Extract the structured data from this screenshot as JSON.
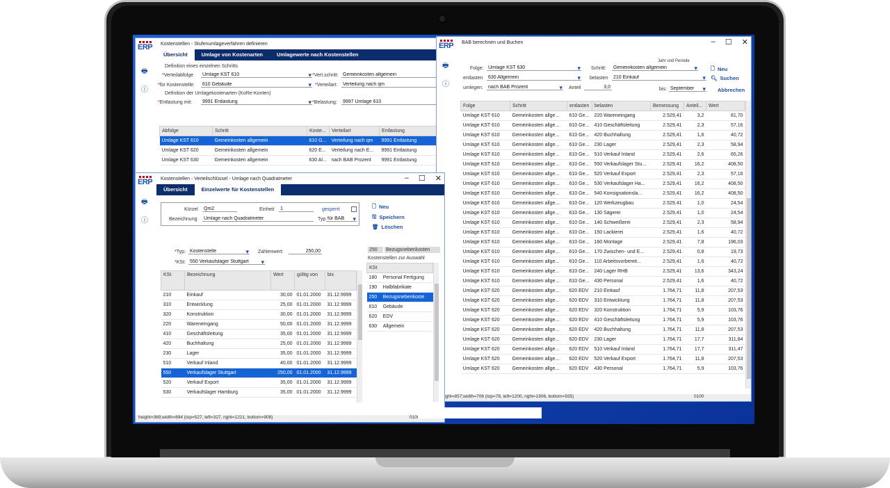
{
  "win1": {
    "title": "Kostenstellen - Stufenumlageverfahren definieren",
    "tabs": [
      "Übersicht",
      "Umlage von Kostenarten",
      "Umlagewerte nach Kostenstellen"
    ],
    "section1": "Definition eines einzelnen Schritts",
    "verteilabfolge_label": "Verteilabfolge",
    "verteilabfolge_value": "Umlage KST 610",
    "vertschritt_label": "Vert.schritt:",
    "vertschritt_value": "Gemeinkosten allgemein",
    "fuerkst_label": "für Kostenstelle:",
    "fuerkst_value": "610 Gebäude",
    "verteilart_label": "Verteilart:",
    "verteilart_value": "Verteilung nach qm",
    "section2": "Definition der Umlagekostenarten (KoRe-Konten)",
    "entlastung_label": "Entlastung mit:",
    "entlastung_value": "9991 Entlastung",
    "belastung_label": "Belastung:",
    "belastung_value": "9997 Umlage 610",
    "columns": [
      "Abfolge",
      "Schritt",
      "Koste...",
      "Verteilart",
      "Entlastung"
    ],
    "rows": [
      [
        "Umlage KST 610",
        "Gemeinkosten allgemein",
        "610 G...",
        "Verteilung nach qm",
        "9991 Entlastung"
      ],
      [
        "Umlage KST 620",
        "Gemeinkosten allgemein",
        "620 E...",
        "Verteilung nach E...",
        "9991 Entlastung"
      ],
      [
        "Umlage KST 630",
        "Gemeinkosten allgemein",
        "630 Al...",
        "nach BAB Prozent",
        "9991 Entlastung"
      ]
    ]
  },
  "win2": {
    "title": "Kostenstellen - Verteilschlüssel - Umlage nach Quadratmeter",
    "tabs": [
      "Übersicht",
      "Einzelwerte für Kostenstellen"
    ],
    "kuerzel_label": "Kürzel",
    "kuerzel_value": "Qm2",
    "einheit_label": "Einheit",
    "einheit_value": "1",
    "gesperrt_label": "gesperrt",
    "bezeichnung_label": "Bezeichnung",
    "bezeichnung_value": "Umlage nach Quadratmeter",
    "typ_label": "Typ",
    "typ_value": "für BAB",
    "btn_neu": "Neu",
    "btn_speichern": "Speichern",
    "btn_loeschen": "Löschen",
    "typ2_label": "Typ:",
    "typ2_value": "Kostenstelle",
    "zahlenwert_label": "Zahlenwert:",
    "zahlenwert_value": "250,00",
    "kst_label": "KSt:",
    "kst_value": "550 Verkaufslager Stuttgart",
    "side_code": "250",
    "side_name": "Bezugsnebenkosten",
    "side_title": "Kostenstellen zur Auswahl",
    "side_col": "KSt",
    "side_rows": [
      [
        "180",
        "Personal Fertigung"
      ],
      [
        "190",
        "Halbfabrikate"
      ],
      [
        "250",
        "Bezugsnebenkoste"
      ],
      [
        "610",
        "Gebäude"
      ],
      [
        "620",
        "EDV"
      ],
      [
        "630",
        "Allgemein"
      ]
    ],
    "columns": [
      "KSt",
      "Bezeichnung",
      "Wert",
      "gültig von",
      "bis"
    ],
    "rows": [
      [
        "210",
        "Einkauf",
        "30,00",
        "01.01.2000",
        "31.12.9999"
      ],
      [
        "310",
        "Entwicklung",
        "25,00",
        "01.01.2000",
        "31.12.9999"
      ],
      [
        "320",
        "Konstruktion",
        "30,00",
        "01.01.2000",
        "31.12.9999"
      ],
      [
        "220",
        "Wareneingang",
        "50,00",
        "01.01.2000",
        "31.12.9999"
      ],
      [
        "410",
        "Geschäftsleitung",
        "35,00",
        "01.01.2000",
        "31.12.9999"
      ],
      [
        "420",
        "Buchhaltung",
        "25,00",
        "01.01.2000",
        "31.12.9999"
      ],
      [
        "230",
        "Lager",
        "35,00",
        "01.01.2000",
        "31.12.9999"
      ],
      [
        "510",
        "Verkauf Inland",
        "40,00",
        "01.01.2000",
        "31.12.9999"
      ],
      [
        "550",
        "Verkaufslager Stuttgart",
        "250,00",
        "01.01.2000",
        "31.12.9999"
      ],
      [
        "520",
        "Verkauf Export",
        "35,00",
        "01.01.2000",
        "31.12.9999"
      ],
      [
        "530",
        "Verkaufslager Hamburg",
        "35,00",
        "01.01.2000",
        "31.12.9999"
      ]
    ],
    "status": "height=369;width=894 (top=527, left=327, right=1221, bottom=908)",
    "status_code": "0100"
  },
  "win3": {
    "title": "BAB berechnen und Buchen",
    "folge_label": "Folge:",
    "folge_value": "Umlage KST 630",
    "schritt_label": "Schritt:",
    "schritt_value": "Gemeinkosten allgemein",
    "jahr_label": "Jahr und Periode",
    "entlasten_label": "entlasten",
    "entlasten_value": "630 Allgemein",
    "belasten_label": "belasten",
    "belasten_value": "210 Einkauf",
    "umlegen_label": "umlegen:",
    "umlegen_value": "nach BAB Prozent",
    "anteil_label": "Anteil",
    "anteil_value": "3,0",
    "bis_label": "bis:",
    "bis_value": "September",
    "btn_neu": "Neu",
    "btn_suchen": "Suchen",
    "btn_abbrechen": "Abbrechen",
    "columns": [
      "Folge",
      "Schritt",
      "entlasten",
      "belasten",
      "Bemessung",
      "Anteil...",
      "Wert"
    ],
    "rows": [
      [
        "Umlage KST 610",
        "Gemeinkosten allge...",
        "610 Ge...",
        "220 Wareneingang",
        "2.529,41",
        "3,2",
        "81,70"
      ],
      [
        "Umlage KST 610",
        "Gemeinkosten allge...",
        "610 Ge...",
        "410 Geschäftsleitung",
        "2.529,41",
        "2,3",
        "57,16"
      ],
      [
        "Umlage KST 610",
        "Gemeinkosten allge...",
        "610 Ge...",
        "420 Buchhaltung",
        "2.529,41",
        "1,6",
        "40,72"
      ],
      [
        "Umlage KST 610",
        "Gemeinkosten allge...",
        "610 Ge...",
        "230 Lager",
        "2.529,41",
        "2,3",
        "58,94"
      ],
      [
        "Umlage KST 610",
        "Gemeinkosten allge...",
        "610 Ge...",
        "510 Verkauf Inland",
        "2.529,41",
        "2,6",
        "65,26"
      ],
      [
        "Umlage KST 610",
        "Gemeinkosten allge...",
        "610 Ge...",
        "550 Verkaufslager Stu...",
        "2.529,41",
        "16,2",
        "408,50"
      ],
      [
        "Umlage KST 610",
        "Gemeinkosten allge...",
        "610 Ge...",
        "520 Verkauf Export",
        "2.529,41",
        "2,3",
        "57,16"
      ],
      [
        "Umlage KST 610",
        "Gemeinkosten allge...",
        "610 Ge...",
        "530 Verkaufslager Ha...",
        "2.529,41",
        "16,2",
        "408,50"
      ],
      [
        "Umlage KST 610",
        "Gemeinkosten allge...",
        "610 Ge...",
        "540 Konsignationsla...",
        "2.529,41",
        "16,2",
        "408,50"
      ],
      [
        "Umlage KST 610",
        "Gemeinkosten allge...",
        "610 Ge...",
        "120 Werkzeugbau",
        "2.529,41",
        "1,0",
        "24,54"
      ],
      [
        "Umlage KST 610",
        "Gemeinkosten allge...",
        "610 Ge...",
        "130 Sägerei",
        "2.529,41",
        "1,0",
        "24,54"
      ],
      [
        "Umlage KST 610",
        "Gemeinkosten allge...",
        "610 Ge...",
        "140 Schweißerei",
        "2.529,41",
        "2,3",
        "58,94"
      ],
      [
        "Umlage KST 610",
        "Gemeinkosten allge...",
        "610 Ge...",
        "150 Lackierei",
        "2.529,41",
        "1,6",
        "40,72"
      ],
      [
        "Umlage KST 610",
        "Gemeinkosten allge...",
        "610 Ge...",
        "160 Montage",
        "2.529,41",
        "7,8",
        "196,03"
      ],
      [
        "Umlage KST 610",
        "Gemeinkosten allge...",
        "610 Ge...",
        "170 Zwischen- und E...",
        "2.529,41",
        "0,8",
        "19,73"
      ],
      [
        "Umlage KST 610",
        "Gemeinkosten allge...",
        "610 Ge...",
        "110 Arbeitsvorbereit...",
        "2.529,41",
        "1,6",
        "40,72"
      ],
      [
        "Umlage KST 610",
        "Gemeinkosten allge...",
        "610 Ge...",
        "240 Lager RHB",
        "2.529,41",
        "13,6",
        "343,24"
      ],
      [
        "Umlage KST 610",
        "Gemeinkosten allge...",
        "610 Ge...",
        "430 Personal",
        "2.529,41",
        "1,6",
        "40,72"
      ],
      [
        "Umlage KST 620",
        "Gemeinkosten allge...",
        "620 EDV",
        "210 Einkauf",
        "1.764,71",
        "11,8",
        "207,53"
      ],
      [
        "Umlage KST 620",
        "Gemeinkosten allge...",
        "620 EDV",
        "310 Entwicklung",
        "1.764,71",
        "11,8",
        "207,53"
      ],
      [
        "Umlage KST 620",
        "Gemeinkosten allge...",
        "620 EDV",
        "320 Konstruktion",
        "1.764,71",
        "5,9",
        "103,76"
      ],
      [
        "Umlage KST 620",
        "Gemeinkosten allge...",
        "620 EDV",
        "410 Geschäftsleitung",
        "1.764,71",
        "5,9",
        "103,76"
      ],
      [
        "Umlage KST 620",
        "Gemeinkosten allge...",
        "620 EDV",
        "420 Buchhaltung",
        "1.764,71",
        "11,8",
        "207,53"
      ],
      [
        "Umlage KST 620",
        "Gemeinkosten allge...",
        "620 EDV",
        "230 Lager",
        "1.764,71",
        "17,7",
        "311,84"
      ],
      [
        "Umlage KST 620",
        "Gemeinkosten allge...",
        "620 EDV",
        "510 Verkauf Inland",
        "1.764,71",
        "17,7",
        "311,47"
      ],
      [
        "Umlage KST 620",
        "Gemeinkosten allge...",
        "620 EDV",
        "520 Verkauf Export",
        "1.764,71",
        "11,8",
        "207,53"
      ],
      [
        "Umlage KST 620",
        "Gemeinkosten allge...",
        "620 EDV",
        "430 Personal",
        "1.764,71",
        "5,9",
        "103,76"
      ]
    ],
    "status": "height=857;width=706 (top=78, left=1200, right=1906, bottom=935)",
    "status_code": "0100"
  }
}
